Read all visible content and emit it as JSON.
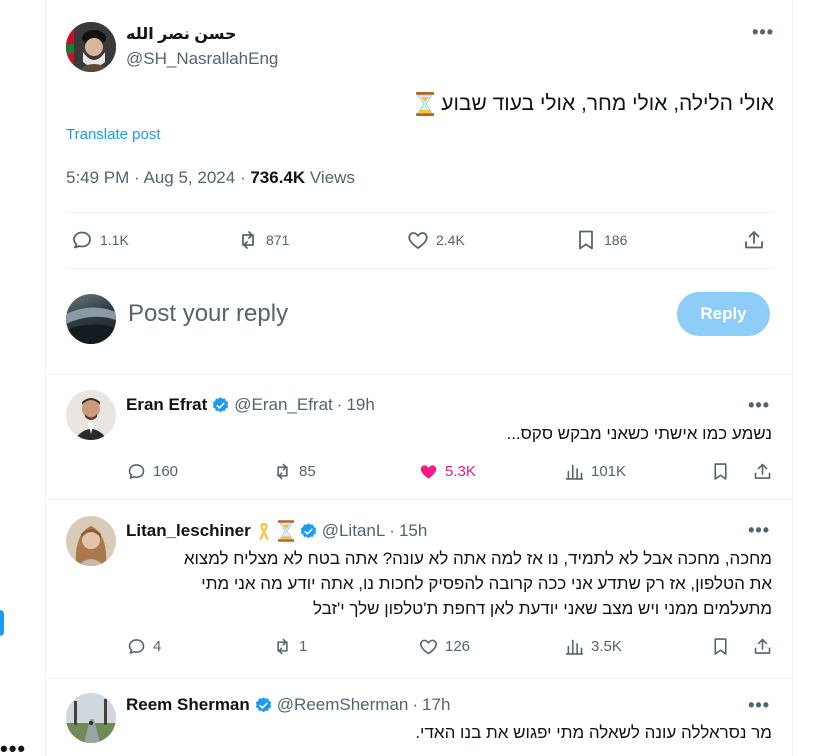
{
  "main_tweet": {
    "author_name": "حسن نصر الله",
    "author_handle": "@SH_NasrallahEng",
    "text": "אולי הלילה, אולי מחר, אולי בעוד שבוע",
    "translate_label": "Translate post",
    "time": "5:49 PM",
    "date": "Aug 5, 2024",
    "views_count": "736.4K",
    "views_label": "Views",
    "replies": "1.1K",
    "reposts": "871",
    "likes": "2.4K",
    "bookmarks": "186"
  },
  "composer": {
    "placeholder": "Post your reply",
    "button_label": "Reply"
  },
  "replies": [
    {
      "name": "Eran Efrat",
      "handle": "@Eran_Efrat",
      "time": "19h",
      "text": "נשמע כמו אישתי כשאני מבקש סקס...",
      "replies": "160",
      "reposts": "85",
      "likes": "5.3K",
      "views": "101K"
    },
    {
      "name": "Litan_leschiner",
      "handle": "@LitanL",
      "time": "15h",
      "text_lines": [
        "מחכה, מחכה אבל לא לתמיד, נו אז למה אתה לא עונה? אתה בטח לא מצליח למצוא",
        "את הטלפון, אז רק שתדע אני ככה קרובה להפסיק לחכות נו, אתה יודע מה אני מתי",
        "מתעלמים ממני ויש מצב שאני יודעת לאן דחפת ת'טלפון שלך י'זבל"
      ],
      "replies": "4",
      "reposts": "1",
      "likes": "126",
      "views": "3.5K"
    },
    {
      "name": "Reem Sherman",
      "handle": "@ReemSherman",
      "time": "17h",
      "text": "מר נסראללה עונה לשאלה מתי יפגוש את בנו האדי."
    }
  ],
  "icons": {
    "verified_color": "#1d9bf0",
    "like_color": "#f91880",
    "link_color": "#1d9bf0"
  }
}
